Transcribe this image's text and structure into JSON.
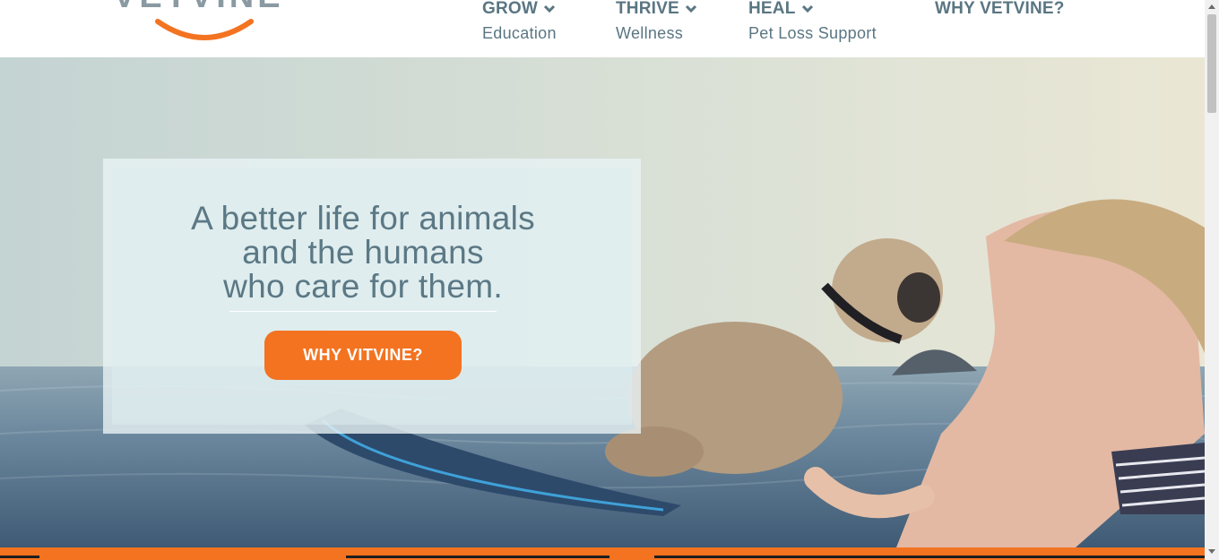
{
  "header": {
    "logo_text": "VETVINE",
    "nav": [
      {
        "title": "GROW",
        "subtitle": "Education",
        "has_dropdown": true
      },
      {
        "title": "THRIVE",
        "subtitle": "Wellness",
        "has_dropdown": true
      },
      {
        "title": "HEAL",
        "subtitle": "Pet Loss Support",
        "has_dropdown": true
      },
      {
        "title": "WHY VETVINE?",
        "subtitle": "",
        "has_dropdown": false
      }
    ]
  },
  "hero": {
    "headline_lines": [
      "A better life for animals",
      "and the humans",
      "who care for them."
    ],
    "cta_label": "WHY VITVINE?"
  },
  "icons": [
    "chevron-down-icon",
    "scroll-up-arrow-icon",
    "scroll-down-arrow-icon"
  ],
  "colors": {
    "accent": "#f37321",
    "nav_text": "#5a7682",
    "headline_text": "#5b7885",
    "logo_text": "#8a9aa2"
  }
}
